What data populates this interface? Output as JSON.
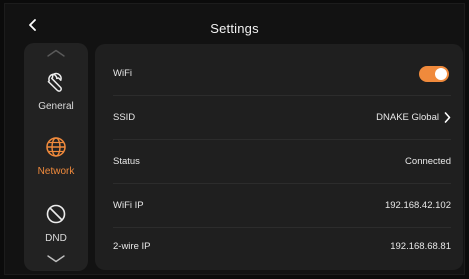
{
  "header": {
    "title": "Settings",
    "back_icon": "chevron-left-icon"
  },
  "sidebar": {
    "scroll_up_icon": "chevron-up-icon",
    "scroll_down_icon": "chevron-down-icon",
    "items": [
      {
        "label": "General",
        "icon": "wrench-icon",
        "active": false
      },
      {
        "label": "Network",
        "icon": "globe-icon",
        "active": true
      },
      {
        "label": "DND",
        "icon": "block-icon",
        "active": false
      }
    ]
  },
  "network": {
    "wifi": {
      "label": "WiFi",
      "enabled": true
    },
    "ssid": {
      "label": "SSID",
      "value": "DNAKE Global"
    },
    "status": {
      "label": "Status",
      "value": "Connected"
    },
    "wifi_ip": {
      "label": "WiFi IP",
      "value": "192.168.42.102"
    },
    "wire_ip": {
      "label": "2-wire IP",
      "value": "192.168.68.81"
    }
  },
  "colors": {
    "accent": "#f08a3c",
    "background": "#121212",
    "panel": "#1f1f1f",
    "sidebar": "#222222"
  }
}
